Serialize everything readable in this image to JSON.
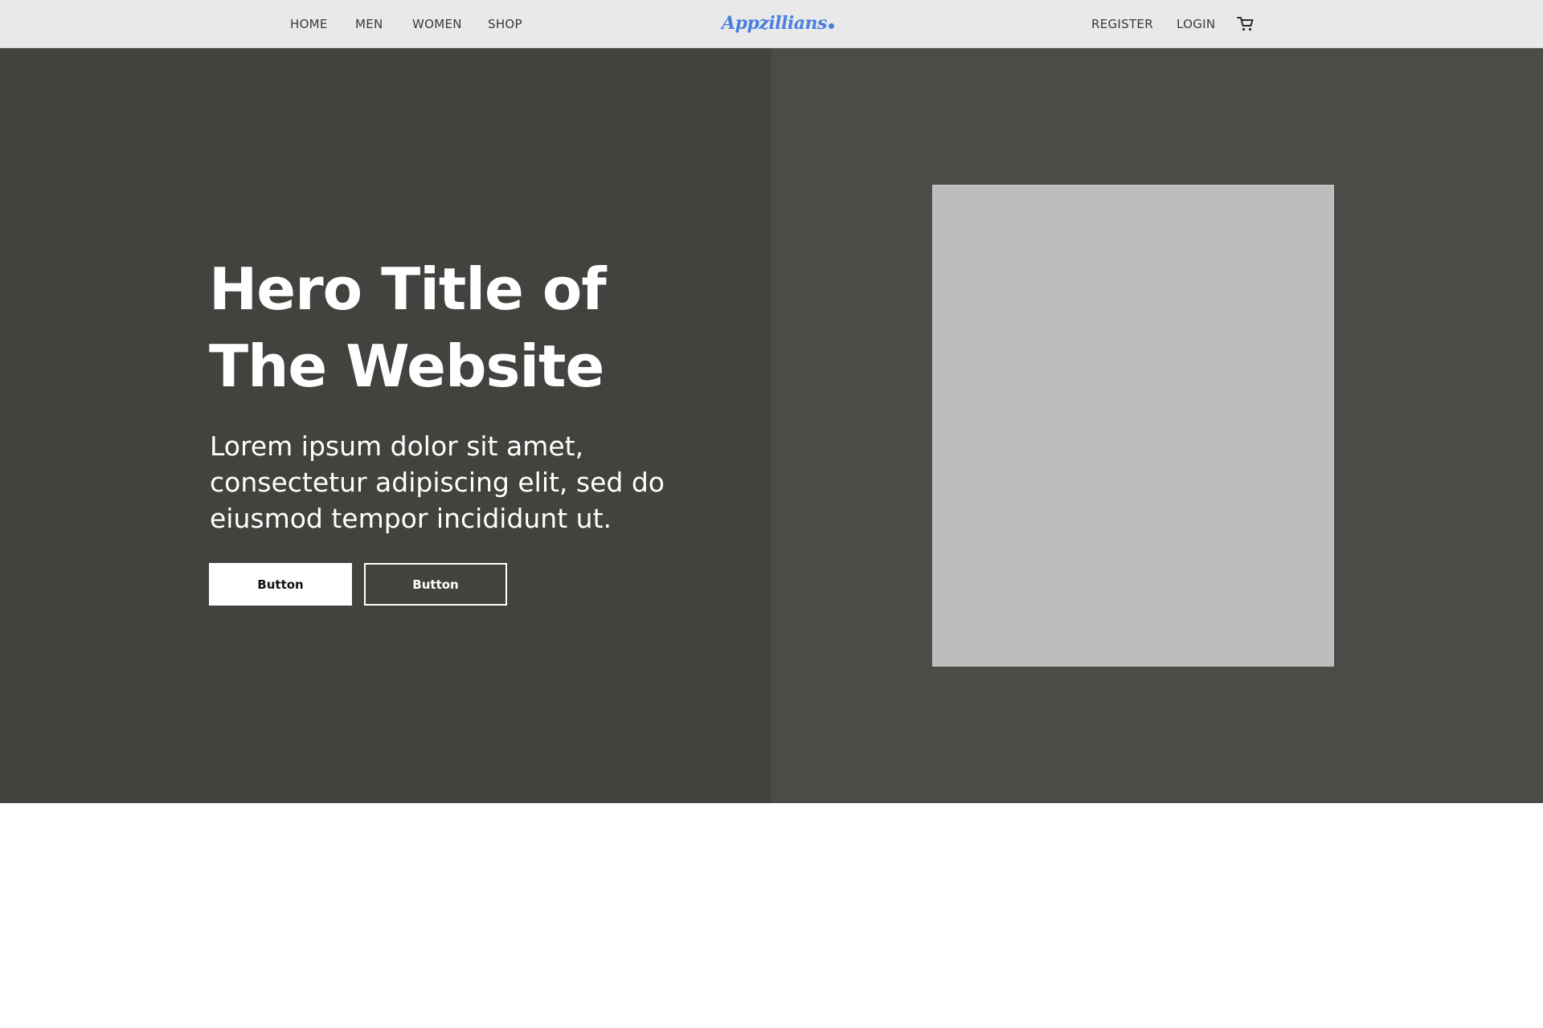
{
  "nav": {
    "left_links": [
      {
        "label": "HOME"
      },
      {
        "label": "MEN"
      },
      {
        "label": "WOMEN"
      },
      {
        "label": "SHOP"
      }
    ],
    "logo_text": "Appzillians",
    "right_links": [
      {
        "label": "REGISTER"
      },
      {
        "label": "LOGIN"
      }
    ],
    "cart_icon": "shopping-cart-icon"
  },
  "hero": {
    "title_lines": [
      "Hero Title of",
      "The Website"
    ],
    "subtitle_lines": [
      "Lorem ipsum dolor sit amet,",
      "consectetur adipiscing elit, sed do",
      "eiusmod tempor incididunt ut."
    ],
    "primary_button_label": "Button",
    "secondary_button_label": "Button"
  },
  "colors": {
    "nav_background": "#e9e9e9",
    "logo_accent": "#4a7fe0",
    "hero_left_background": "#42423e",
    "hero_right_background": "#4b4b47",
    "image_placeholder": "#bdbdbd"
  }
}
